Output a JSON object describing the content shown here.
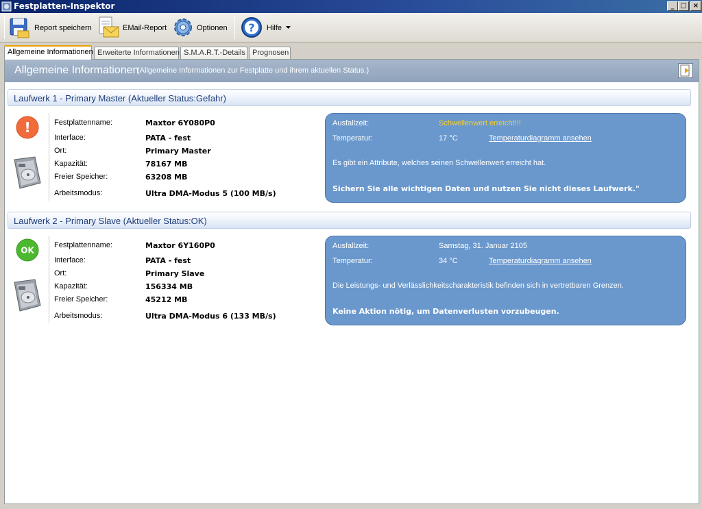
{
  "window": {
    "title": "Festplatten-Inspektor"
  },
  "toolbar": {
    "report_label": "Report speichern",
    "email_label": "EMail-Report",
    "options_label": "Optionen",
    "help_label": "Hilfe"
  },
  "tabs": [
    {
      "label": "Allgemeine Informationen"
    },
    {
      "label": "Erweiterte Informationen"
    },
    {
      "label": "S.M.A.R.T.-Details"
    },
    {
      "label": "Prognosen"
    }
  ],
  "banner": {
    "title": "Allgemeine Informationen",
    "subtitle": "(Allgemeine Informationen zur Festplatte und ihrem aktuellen Status.)"
  },
  "labels": {
    "name": "Festplattenname:",
    "interface": "Interface:",
    "location": "Ort:",
    "capacity": "Kapazität:",
    "free": "Freier Speicher:",
    "mode": "Arbeitsmodus:",
    "failure": "Ausfallzeit:",
    "temperature": "Temperatur:",
    "temp_link": "Temperaturdiagramm ansehen"
  },
  "drives": [
    {
      "header": "Laufwerk 1 - Primary Master (Aktueller Status:Gefahr)",
      "status_symbol": "!",
      "status_color": "#f26b3a",
      "name": "Maxtor 6Y080P0",
      "interface": "PATA - fest",
      "location": "Primary Master",
      "capacity": "78167 MB",
      "free": "63208 MB",
      "mode": "Ultra DMA-Modus 5 (100 MB/s)",
      "failure": "Schwellenwert erreicht!!!",
      "temperature": "17 °C",
      "message": "Es gibt ein Attribute, welches seinen Schwellenwert erreicht hat.",
      "advice": "Sichern Sie alle wichtigen Daten und nutzen Sie nicht dieses Laufwerk.\""
    },
    {
      "header": "Laufwerk 2 - Primary Slave (Aktueller Status:OK)",
      "status_symbol": "OK",
      "status_color": "#4cb830",
      "name": "Maxtor 6Y160P0",
      "interface": "PATA - fest",
      "location": "Primary Slave",
      "capacity": "156334 MB",
      "free": "45212 MB",
      "mode": "Ultra DMA-Modus 6 (133 MB/s)",
      "failure": "Samstag, 31. Januar 2105",
      "temperature": "34 °C",
      "message": "Die Leistungs- und Verlässlichkeitscharakteristik befinden sich in vertretbaren Grenzen.",
      "advice": "Keine Aktion nötig, um Datenverlusten vorzubeugen."
    }
  ]
}
